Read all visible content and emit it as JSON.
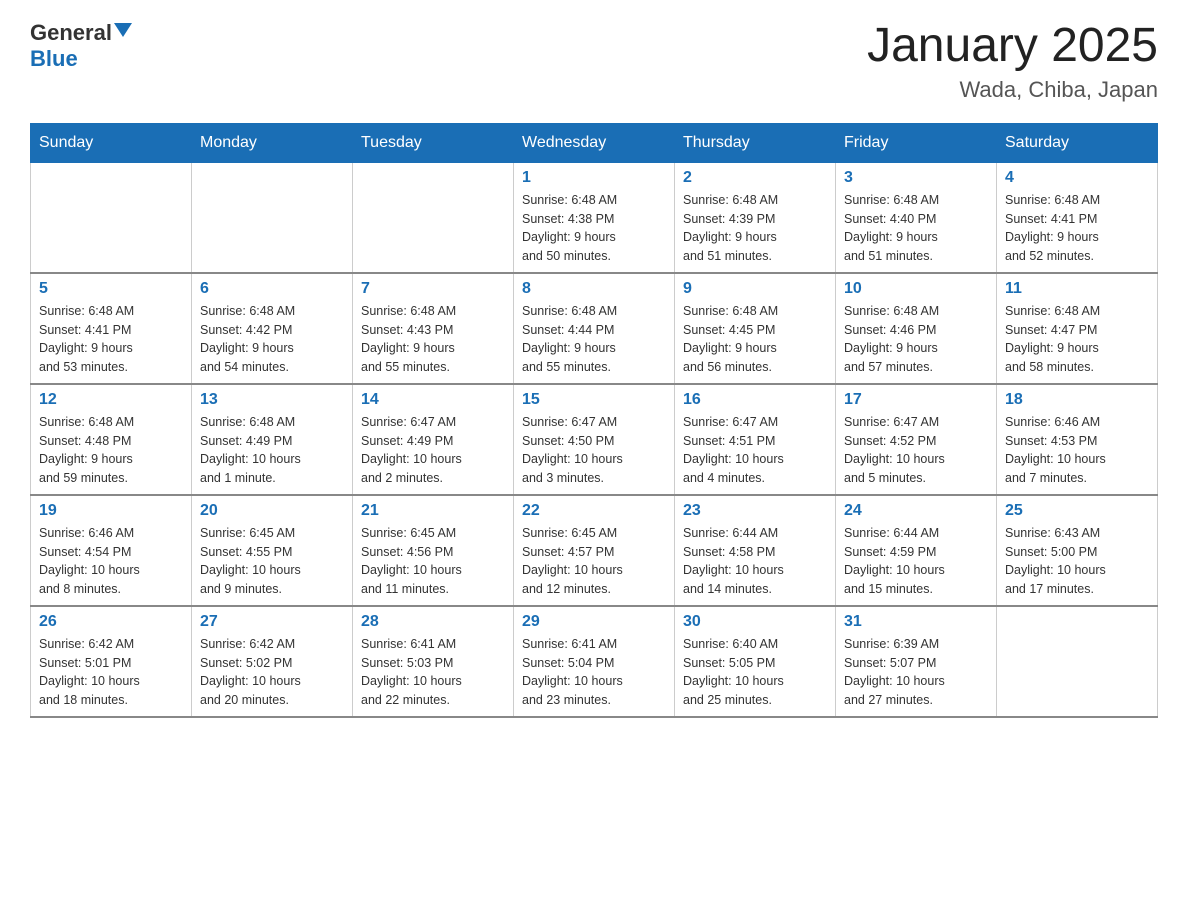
{
  "header": {
    "logo_line1": "General",
    "logo_line2": "Blue",
    "title": "January 2025",
    "subtitle": "Wada, Chiba, Japan"
  },
  "days_of_week": [
    "Sunday",
    "Monday",
    "Tuesday",
    "Wednesday",
    "Thursday",
    "Friday",
    "Saturday"
  ],
  "weeks": [
    [
      {
        "num": "",
        "detail": ""
      },
      {
        "num": "",
        "detail": ""
      },
      {
        "num": "",
        "detail": ""
      },
      {
        "num": "1",
        "detail": "Sunrise: 6:48 AM\nSunset: 4:38 PM\nDaylight: 9 hours\nand 50 minutes."
      },
      {
        "num": "2",
        "detail": "Sunrise: 6:48 AM\nSunset: 4:39 PM\nDaylight: 9 hours\nand 51 minutes."
      },
      {
        "num": "3",
        "detail": "Sunrise: 6:48 AM\nSunset: 4:40 PM\nDaylight: 9 hours\nand 51 minutes."
      },
      {
        "num": "4",
        "detail": "Sunrise: 6:48 AM\nSunset: 4:41 PM\nDaylight: 9 hours\nand 52 minutes."
      }
    ],
    [
      {
        "num": "5",
        "detail": "Sunrise: 6:48 AM\nSunset: 4:41 PM\nDaylight: 9 hours\nand 53 minutes."
      },
      {
        "num": "6",
        "detail": "Sunrise: 6:48 AM\nSunset: 4:42 PM\nDaylight: 9 hours\nand 54 minutes."
      },
      {
        "num": "7",
        "detail": "Sunrise: 6:48 AM\nSunset: 4:43 PM\nDaylight: 9 hours\nand 55 minutes."
      },
      {
        "num": "8",
        "detail": "Sunrise: 6:48 AM\nSunset: 4:44 PM\nDaylight: 9 hours\nand 55 minutes."
      },
      {
        "num": "9",
        "detail": "Sunrise: 6:48 AM\nSunset: 4:45 PM\nDaylight: 9 hours\nand 56 minutes."
      },
      {
        "num": "10",
        "detail": "Sunrise: 6:48 AM\nSunset: 4:46 PM\nDaylight: 9 hours\nand 57 minutes."
      },
      {
        "num": "11",
        "detail": "Sunrise: 6:48 AM\nSunset: 4:47 PM\nDaylight: 9 hours\nand 58 minutes."
      }
    ],
    [
      {
        "num": "12",
        "detail": "Sunrise: 6:48 AM\nSunset: 4:48 PM\nDaylight: 9 hours\nand 59 minutes."
      },
      {
        "num": "13",
        "detail": "Sunrise: 6:48 AM\nSunset: 4:49 PM\nDaylight: 10 hours\nand 1 minute."
      },
      {
        "num": "14",
        "detail": "Sunrise: 6:47 AM\nSunset: 4:49 PM\nDaylight: 10 hours\nand 2 minutes."
      },
      {
        "num": "15",
        "detail": "Sunrise: 6:47 AM\nSunset: 4:50 PM\nDaylight: 10 hours\nand 3 minutes."
      },
      {
        "num": "16",
        "detail": "Sunrise: 6:47 AM\nSunset: 4:51 PM\nDaylight: 10 hours\nand 4 minutes."
      },
      {
        "num": "17",
        "detail": "Sunrise: 6:47 AM\nSunset: 4:52 PM\nDaylight: 10 hours\nand 5 minutes."
      },
      {
        "num": "18",
        "detail": "Sunrise: 6:46 AM\nSunset: 4:53 PM\nDaylight: 10 hours\nand 7 minutes."
      }
    ],
    [
      {
        "num": "19",
        "detail": "Sunrise: 6:46 AM\nSunset: 4:54 PM\nDaylight: 10 hours\nand 8 minutes."
      },
      {
        "num": "20",
        "detail": "Sunrise: 6:45 AM\nSunset: 4:55 PM\nDaylight: 10 hours\nand 9 minutes."
      },
      {
        "num": "21",
        "detail": "Sunrise: 6:45 AM\nSunset: 4:56 PM\nDaylight: 10 hours\nand 11 minutes."
      },
      {
        "num": "22",
        "detail": "Sunrise: 6:45 AM\nSunset: 4:57 PM\nDaylight: 10 hours\nand 12 minutes."
      },
      {
        "num": "23",
        "detail": "Sunrise: 6:44 AM\nSunset: 4:58 PM\nDaylight: 10 hours\nand 14 minutes."
      },
      {
        "num": "24",
        "detail": "Sunrise: 6:44 AM\nSunset: 4:59 PM\nDaylight: 10 hours\nand 15 minutes."
      },
      {
        "num": "25",
        "detail": "Sunrise: 6:43 AM\nSunset: 5:00 PM\nDaylight: 10 hours\nand 17 minutes."
      }
    ],
    [
      {
        "num": "26",
        "detail": "Sunrise: 6:42 AM\nSunset: 5:01 PM\nDaylight: 10 hours\nand 18 minutes."
      },
      {
        "num": "27",
        "detail": "Sunrise: 6:42 AM\nSunset: 5:02 PM\nDaylight: 10 hours\nand 20 minutes."
      },
      {
        "num": "28",
        "detail": "Sunrise: 6:41 AM\nSunset: 5:03 PM\nDaylight: 10 hours\nand 22 minutes."
      },
      {
        "num": "29",
        "detail": "Sunrise: 6:41 AM\nSunset: 5:04 PM\nDaylight: 10 hours\nand 23 minutes."
      },
      {
        "num": "30",
        "detail": "Sunrise: 6:40 AM\nSunset: 5:05 PM\nDaylight: 10 hours\nand 25 minutes."
      },
      {
        "num": "31",
        "detail": "Sunrise: 6:39 AM\nSunset: 5:07 PM\nDaylight: 10 hours\nand 27 minutes."
      },
      {
        "num": "",
        "detail": ""
      }
    ]
  ]
}
